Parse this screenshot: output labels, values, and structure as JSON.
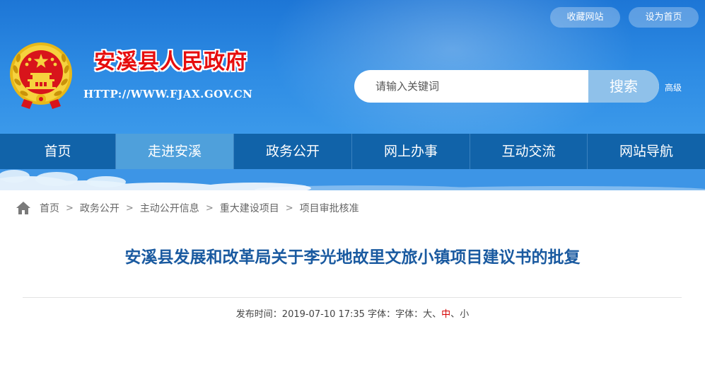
{
  "header": {
    "site_name": "安溪县人民政府",
    "site_url": "HTTP://WWW.FJAX.GOV.CN",
    "top_links": [
      "收藏网站",
      "设为首页"
    ],
    "search": {
      "placeholder": "请输入关键词",
      "button_label": "搜索",
      "advanced_label": "高级"
    }
  },
  "nav": {
    "items": [
      "首页",
      "走进安溪",
      "政务公开",
      "网上办事",
      "互动交流",
      "网站导航"
    ],
    "active_index": 1
  },
  "breadcrumb": {
    "items": [
      "首页",
      "政务公开",
      "主动公开信息",
      "重大建设项目",
      "项目审批核准"
    ],
    "separator": ">"
  },
  "article": {
    "title": "安溪县发展和改革局关于李光地故里文旅小镇项目建议书的批复",
    "publish_label": "发布时间：",
    "publish_time": "2019-07-10 17:35",
    "font_label_1": "字体：",
    "font_label_2": "字体：",
    "font_sizes": [
      "大",
      "中",
      "小"
    ],
    "font_size_separator": "、"
  },
  "colors": {
    "header_blue": "#2e8ce4",
    "nav_blue": "#1163a9",
    "nav_active": "#4fa0db",
    "title_blue": "#1a5aa0",
    "site_name_red": "#e60d0d",
    "font_size_selected": "#d40000"
  },
  "icons": {
    "emblem": "national-emblem-icon",
    "home": "home-icon"
  }
}
